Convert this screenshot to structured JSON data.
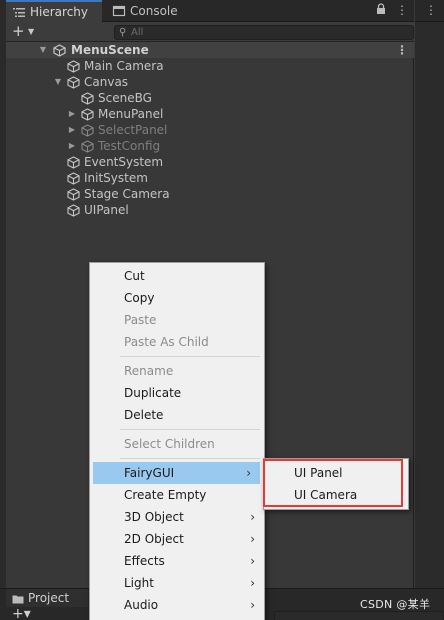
{
  "tabs": [
    {
      "label": "Hierarchy",
      "icon": "hierarchy-list-icon",
      "active": true
    },
    {
      "label": "Console",
      "icon": "console-icon",
      "active": false
    }
  ],
  "toolbar": {
    "add_label": "+",
    "search_placeholder": "All"
  },
  "tree": [
    {
      "label": "MenuScene",
      "depth": 0,
      "type": "scene",
      "expanded": true
    },
    {
      "label": "Main Camera",
      "depth": 1,
      "type": "object"
    },
    {
      "label": "Canvas",
      "depth": 1,
      "type": "object",
      "expanded": true
    },
    {
      "label": "SceneBG",
      "depth": 2,
      "type": "object"
    },
    {
      "label": "MenuPanel",
      "depth": 2,
      "type": "object",
      "collapsed": true
    },
    {
      "label": "SelectPanel",
      "depth": 2,
      "type": "object",
      "collapsed": true,
      "disabled": true
    },
    {
      "label": "TestConfig",
      "depth": 2,
      "type": "object",
      "collapsed": true,
      "disabled": true
    },
    {
      "label": "EventSystem",
      "depth": 1,
      "type": "object"
    },
    {
      "label": "InitSystem",
      "depth": 1,
      "type": "object"
    },
    {
      "label": "Stage Camera",
      "depth": 1,
      "type": "object"
    },
    {
      "label": "UIPanel",
      "depth": 1,
      "type": "object"
    }
  ],
  "context_menu": {
    "items": [
      {
        "label": "Cut",
        "disabled": false
      },
      {
        "label": "Copy",
        "disabled": false
      },
      {
        "label": "Paste",
        "disabled": true
      },
      {
        "label": "Paste As Child",
        "disabled": true
      },
      {
        "label": "Rename",
        "disabled": true
      },
      {
        "label": "Duplicate",
        "disabled": false
      },
      {
        "label": "Delete",
        "disabled": false
      },
      {
        "label": "Select Children",
        "disabled": true
      },
      {
        "label": "FairyGUI",
        "disabled": false,
        "submenu": true,
        "highlighted": true
      },
      {
        "label": "Create Empty",
        "disabled": false
      },
      {
        "label": "3D Object",
        "disabled": false,
        "submenu": true
      },
      {
        "label": "2D Object",
        "disabled": false,
        "submenu": true
      },
      {
        "label": "Effects",
        "disabled": false,
        "submenu": true
      },
      {
        "label": "Light",
        "disabled": false,
        "submenu": true
      },
      {
        "label": "Audio",
        "disabled": false,
        "submenu": true
      }
    ]
  },
  "submenu": {
    "items": [
      {
        "label": "UI Panel"
      },
      {
        "label": "UI Camera"
      }
    ]
  },
  "bottom": {
    "project_tab": "Project"
  },
  "watermark": "CSDN @某羊",
  "colors": {
    "accent": "#3a79bb",
    "menu_highlight": "#99c9ef",
    "annotation": "#e23b3b"
  }
}
